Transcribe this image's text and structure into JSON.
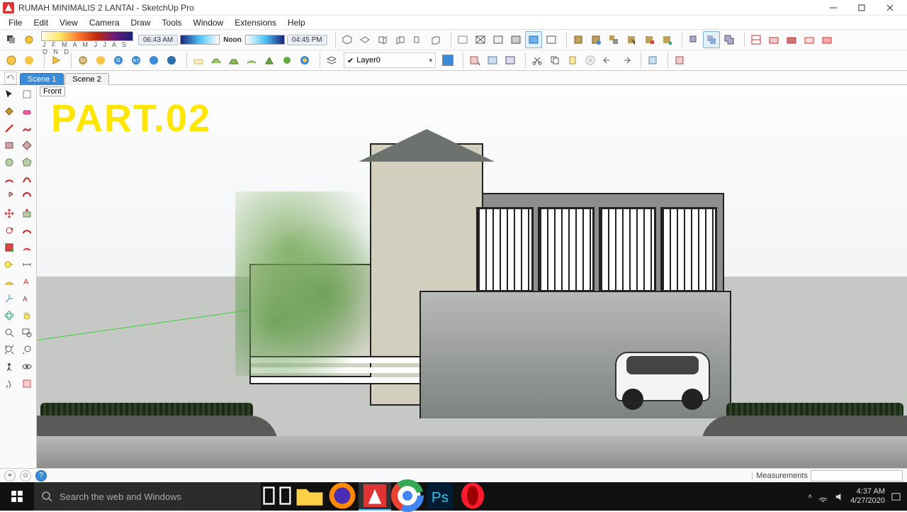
{
  "window": {
    "title": "RUMAH MINIMALIS 2 LANTAI - SketchUp Pro"
  },
  "menu": [
    "File",
    "Edit",
    "View",
    "Camera",
    "Draw",
    "Tools",
    "Window",
    "Extensions",
    "Help"
  ],
  "shadowbar": {
    "months": "J F M A M J J A S O N D",
    "time_left": "06:43 AM",
    "noon": "Noon",
    "time_right": "04:45 PM"
  },
  "layer": {
    "selected": "Layer0"
  },
  "scenes": {
    "tabs": [
      "Scene 1",
      "Scene 2"
    ],
    "active_index": 0
  },
  "viewport": {
    "view_label": "Front",
    "overlay_text": "PART.02"
  },
  "statusbar": {
    "measurements_label": "Measurements",
    "measurements_value": ""
  },
  "taskbar": {
    "search_placeholder": "Search the web and Windows",
    "time": "4:37 AM",
    "date": "4/27/2020"
  }
}
